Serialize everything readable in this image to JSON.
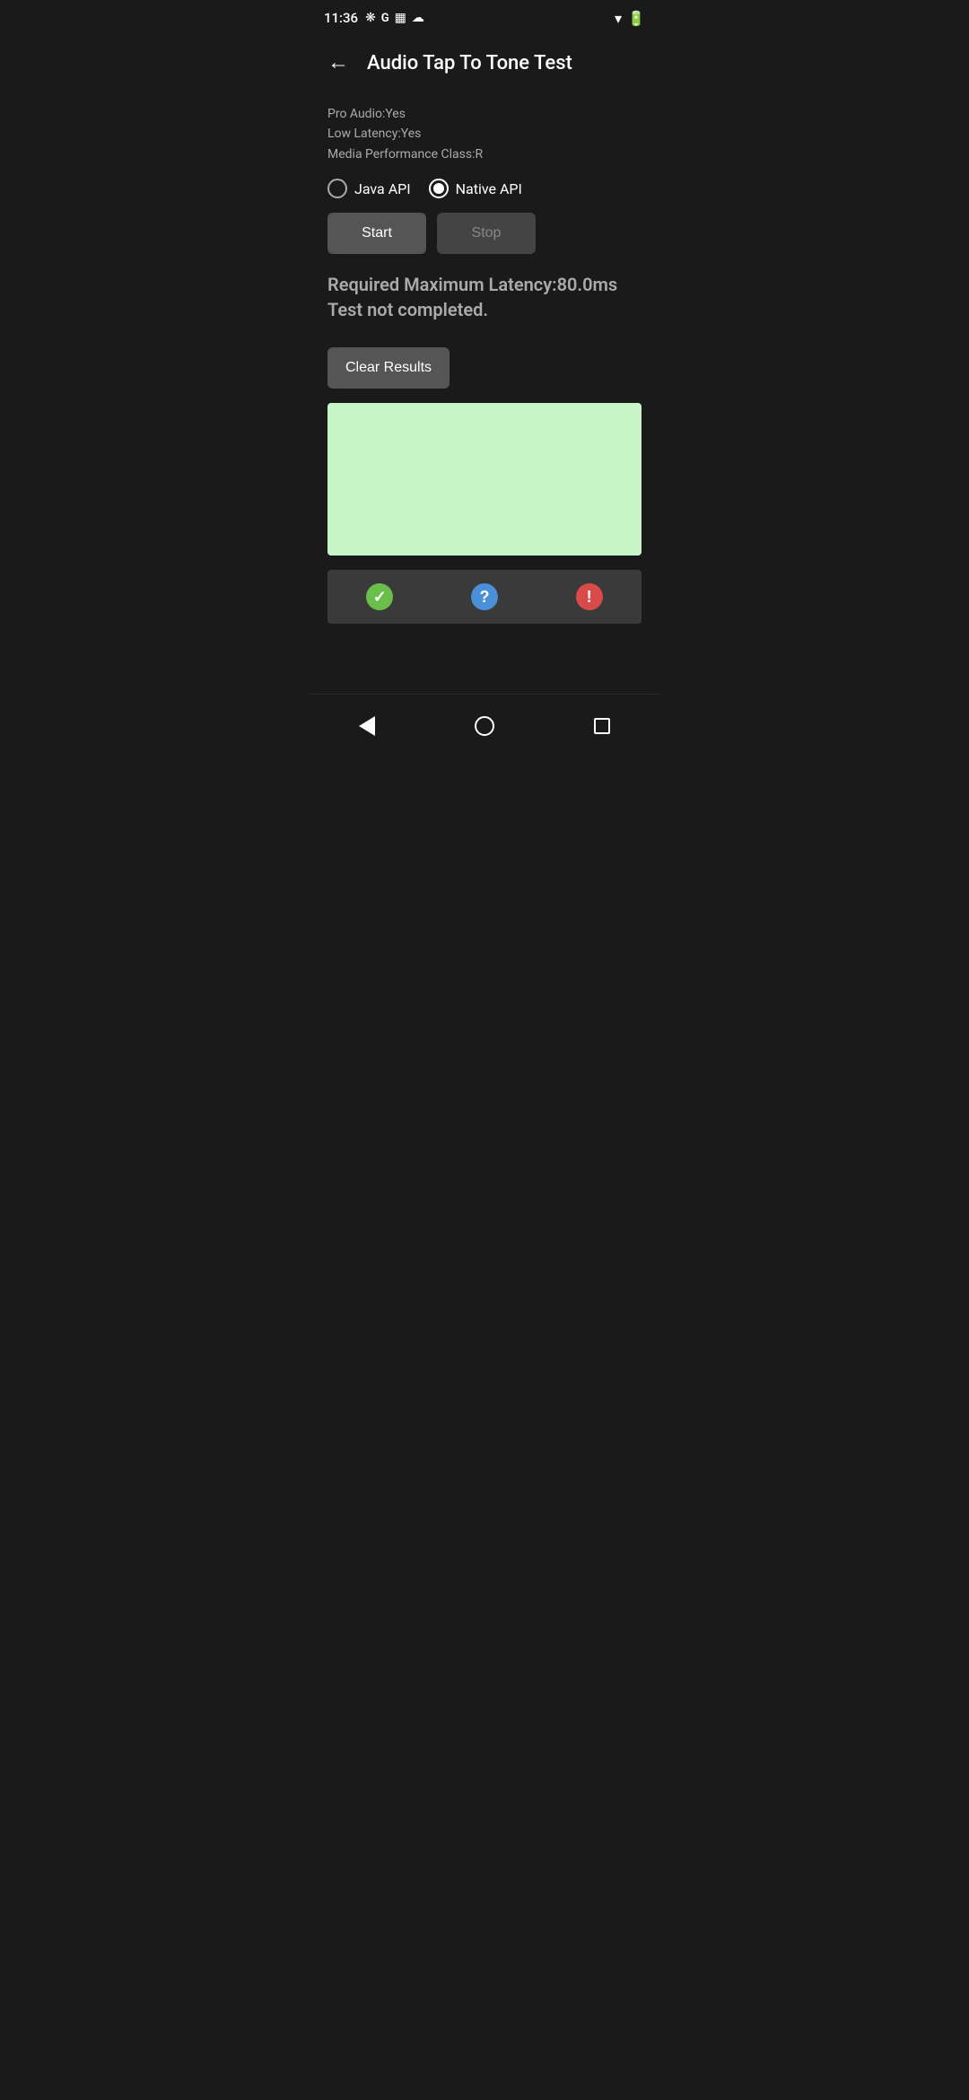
{
  "statusBar": {
    "time": "11:36",
    "icons": [
      "fan",
      "google",
      "calendar",
      "cloud"
    ],
    "rightIcons": [
      "wifi",
      "battery"
    ]
  },
  "toolbar": {
    "backLabel": "←",
    "title": "Audio Tap To Tone Test"
  },
  "info": {
    "proAudio": "Pro Audio:Yes",
    "lowLatency": "Low Latency:Yes",
    "mediaPerformanceClass": "Media Performance Class:R"
  },
  "radioGroup": {
    "options": [
      {
        "id": "java",
        "label": "Java API",
        "selected": false
      },
      {
        "id": "native",
        "label": "Native API",
        "selected": true
      }
    ]
  },
  "buttons": {
    "start": "Start",
    "stop": "Stop"
  },
  "results": {
    "line1": "Required Maximum Latency:80.0ms",
    "line2": "Test not completed."
  },
  "clearResults": "Clear Results",
  "actionButtons": {
    "pass": "✓",
    "info": "?",
    "fail": "!"
  },
  "navBar": {
    "back": "back",
    "home": "home",
    "recents": "recents"
  }
}
